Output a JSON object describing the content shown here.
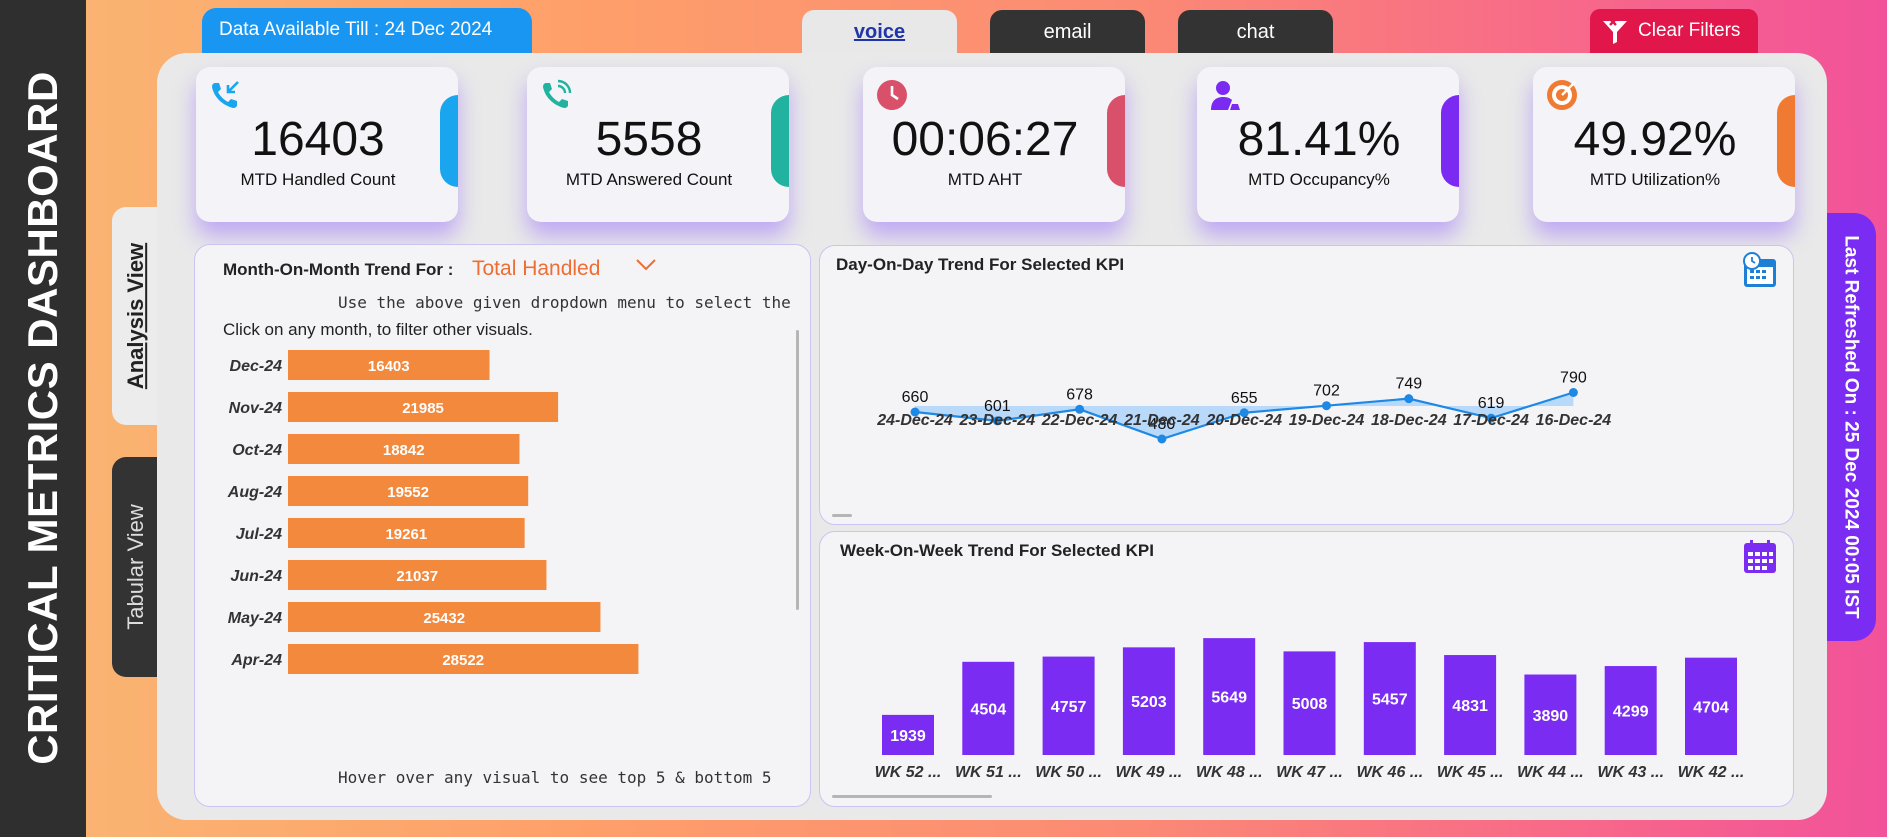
{
  "dashboard_title": "CRITICAL METRICS DASHBOARD",
  "data_available": "Data Available Till : 24 Dec 2024",
  "channels": [
    {
      "label": "voice",
      "active": true
    },
    {
      "label": "email",
      "active": false
    },
    {
      "label": "chat",
      "active": false
    }
  ],
  "clear_filters": "Clear Filters",
  "views": {
    "analysis": "Analysis View",
    "tabular": "Tabular View"
  },
  "last_refreshed": "Last Refreshed On : 25 Dec 2024 00:05 IST",
  "kpis": [
    {
      "value": "16403",
      "label": "MTD Handled Count",
      "icon": "incoming-call-icon",
      "accent": "#1aa6ef"
    },
    {
      "value": "5558",
      "label": "MTD Answered Count",
      "icon": "phone-call-icon",
      "accent": "#21b3a0"
    },
    {
      "value": "00:06:27",
      "label": "MTD AHT",
      "icon": "clock-icon",
      "accent": "#d9506a"
    },
    {
      "value": "81.41%",
      "label": "MTD Occupancy%",
      "icon": "user-headset-icon",
      "accent": "#7b2af2"
    },
    {
      "value": "49.92%",
      "label": "MTD Utilization%",
      "icon": "target-icon",
      "accent": "#f07a32"
    }
  ],
  "mom": {
    "title": "Month-On-Month Trend For :",
    "selected_kpi": "Total Handled",
    "help_text": "Use the above given dropdown menu to select the KPI",
    "click_text": "Click on any month, to filter other visuals.",
    "footer_text": "Hover over any visual to see top 5 & bottom 5",
    "bar_color": "#f2893d"
  },
  "dod": {
    "title": "Day-On-Day Trend For Selected KPI",
    "line_color": "#1e88e5",
    "area_color": "#b3d6fb"
  },
  "wow": {
    "title": "Week-On-Week Trend For Selected KPI",
    "bar_color": "#7a2cf2"
  },
  "chart_data": [
    {
      "type": "bar",
      "orientation": "horizontal",
      "title": "Month-On-Month Trend For : Total Handled",
      "categories": [
        "Dec-24",
        "Nov-24",
        "Oct-24",
        "Aug-24",
        "Jul-24",
        "Jun-24",
        "May-24",
        "Apr-24"
      ],
      "values": [
        16403,
        21985,
        18842,
        19552,
        19261,
        21037,
        25432,
        28522
      ],
      "xlim": [
        0,
        35000
      ]
    },
    {
      "type": "area",
      "title": "Day-On-Day Trend For Selected KPI",
      "categories": [
        "24-Dec-24",
        "23-Dec-24",
        "22-Dec-24",
        "21-Dec-24",
        "20-Dec-24",
        "19-Dec-24",
        "18-Dec-24",
        "17-Dec-24",
        "16-Dec-24"
      ],
      "values": [
        660,
        601,
        678,
        480,
        655,
        702,
        749,
        619,
        790
      ],
      "ylim": [
        0,
        1400
      ]
    },
    {
      "type": "bar",
      "title": "Week-On-Week Trend For Selected KPI",
      "categories": [
        "WK 52 ...",
        "WK 51 ...",
        "WK 50 ...",
        "WK 49 ...",
        "WK 48 ...",
        "WK 47 ...",
        "WK 46 ...",
        "WK 45 ...",
        "WK 44 ...",
        "WK 43 ...",
        "WK 42 ..."
      ],
      "values": [
        1939,
        4504,
        4757,
        5203,
        5649,
        5008,
        5457,
        4831,
        3890,
        4299,
        4704
      ],
      "ylim": [
        0,
        5800
      ]
    }
  ]
}
